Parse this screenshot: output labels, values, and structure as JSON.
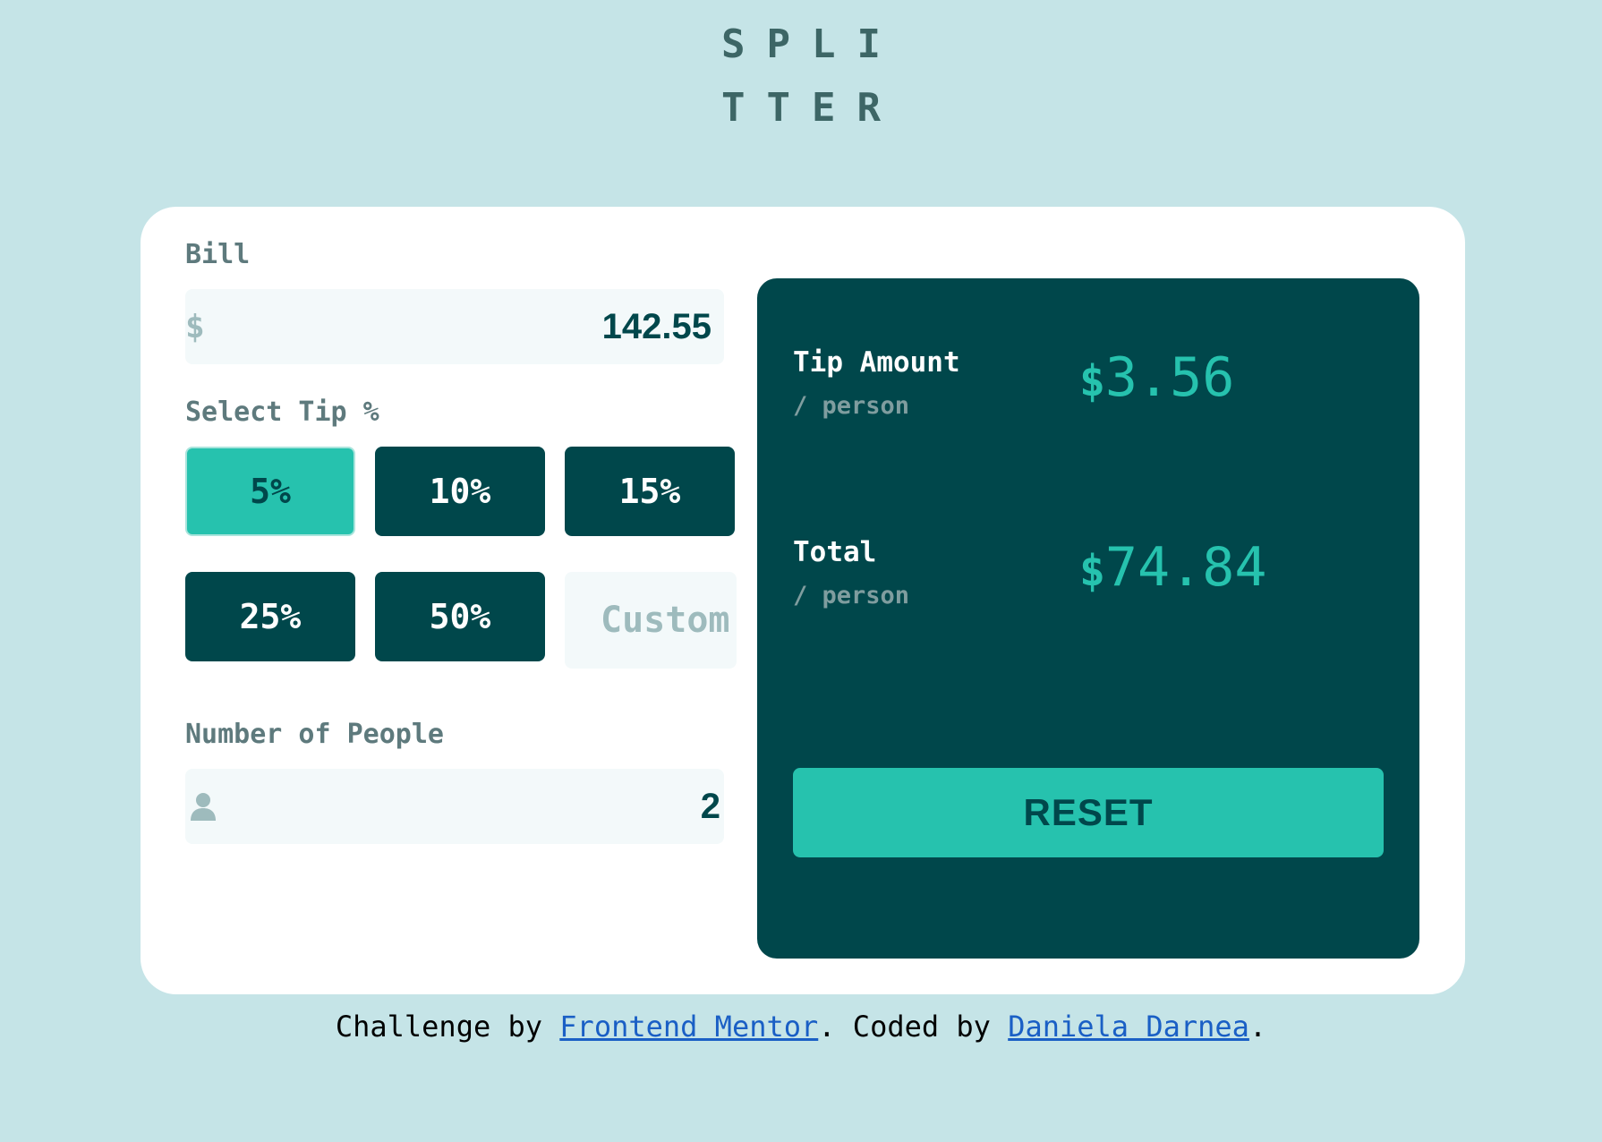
{
  "logo": {
    "line1": "SPLI",
    "line2": "TTER"
  },
  "bill": {
    "label": "Bill",
    "currency_symbol": "$",
    "value": "142.55"
  },
  "tip": {
    "label": "Select Tip %",
    "options": [
      "5%",
      "10%",
      "15%",
      "25%",
      "50%"
    ],
    "selected": "5%",
    "custom_placeholder": "Custom"
  },
  "people": {
    "label": "Number of People",
    "icon": "person-icon",
    "value": "2"
  },
  "results": {
    "tip_amount": {
      "label": "Tip Amount",
      "sub": "/ person",
      "currency": "$",
      "value": "3.56"
    },
    "total": {
      "label": "Total",
      "sub": "/ person",
      "currency": "$",
      "value": "74.84"
    },
    "reset_label": "RESET"
  },
  "footer": {
    "prefix": "Challenge by ",
    "link1": "Frontend Mentor",
    "middle": ". Coded by ",
    "link2": "Daniela Darnea",
    "suffix": "."
  },
  "colors": {
    "background": "#c5e4e7",
    "dark_cyan": "#00474b",
    "strong_cyan": "#26c2ae",
    "card": "#ffffff",
    "input_bg": "#f3f9fa",
    "label_grey": "#5e7a7d"
  }
}
